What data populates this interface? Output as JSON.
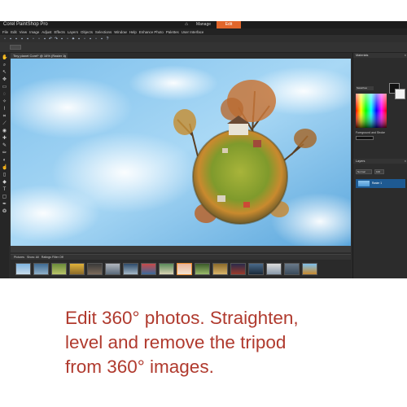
{
  "app": {
    "title": "Corel PaintShop Pro",
    "tabs": [
      {
        "label": "Manage",
        "active": false
      },
      {
        "label": "Edit",
        "active": true
      }
    ],
    "accent_color": "#e2662a"
  },
  "menu": {
    "items": [
      "File",
      "Edit",
      "View",
      "Image",
      "Adjust",
      "Effects",
      "Layers",
      "Objects",
      "Selections",
      "Window",
      "Help",
      "Enhance Photo",
      "Palettes",
      "User Interface"
    ]
  },
  "document": {
    "tab_label": "Tiny planet Corel* @ 16% (Raster 1)",
    "close_label": "×"
  },
  "organizer": {
    "nav_label": "Pictures",
    "filter_label": "Show: All",
    "rating_label": "Ratings Filter Off"
  },
  "panels": {
    "materials": {
      "title": "Materials",
      "dropdown_label": "Swatches"
    },
    "foreground_label": "Foreground and Stroke",
    "layers": {
      "title": "Layers",
      "blend_mode": "Normal",
      "opacity": "100",
      "layer_name": "Raster 1"
    }
  },
  "caption": {
    "line1": "Edit 360° photos. Straighten,",
    "line2": "level and remove the tripod",
    "line3": "from 360° images.",
    "color": "#b03a2e"
  }
}
